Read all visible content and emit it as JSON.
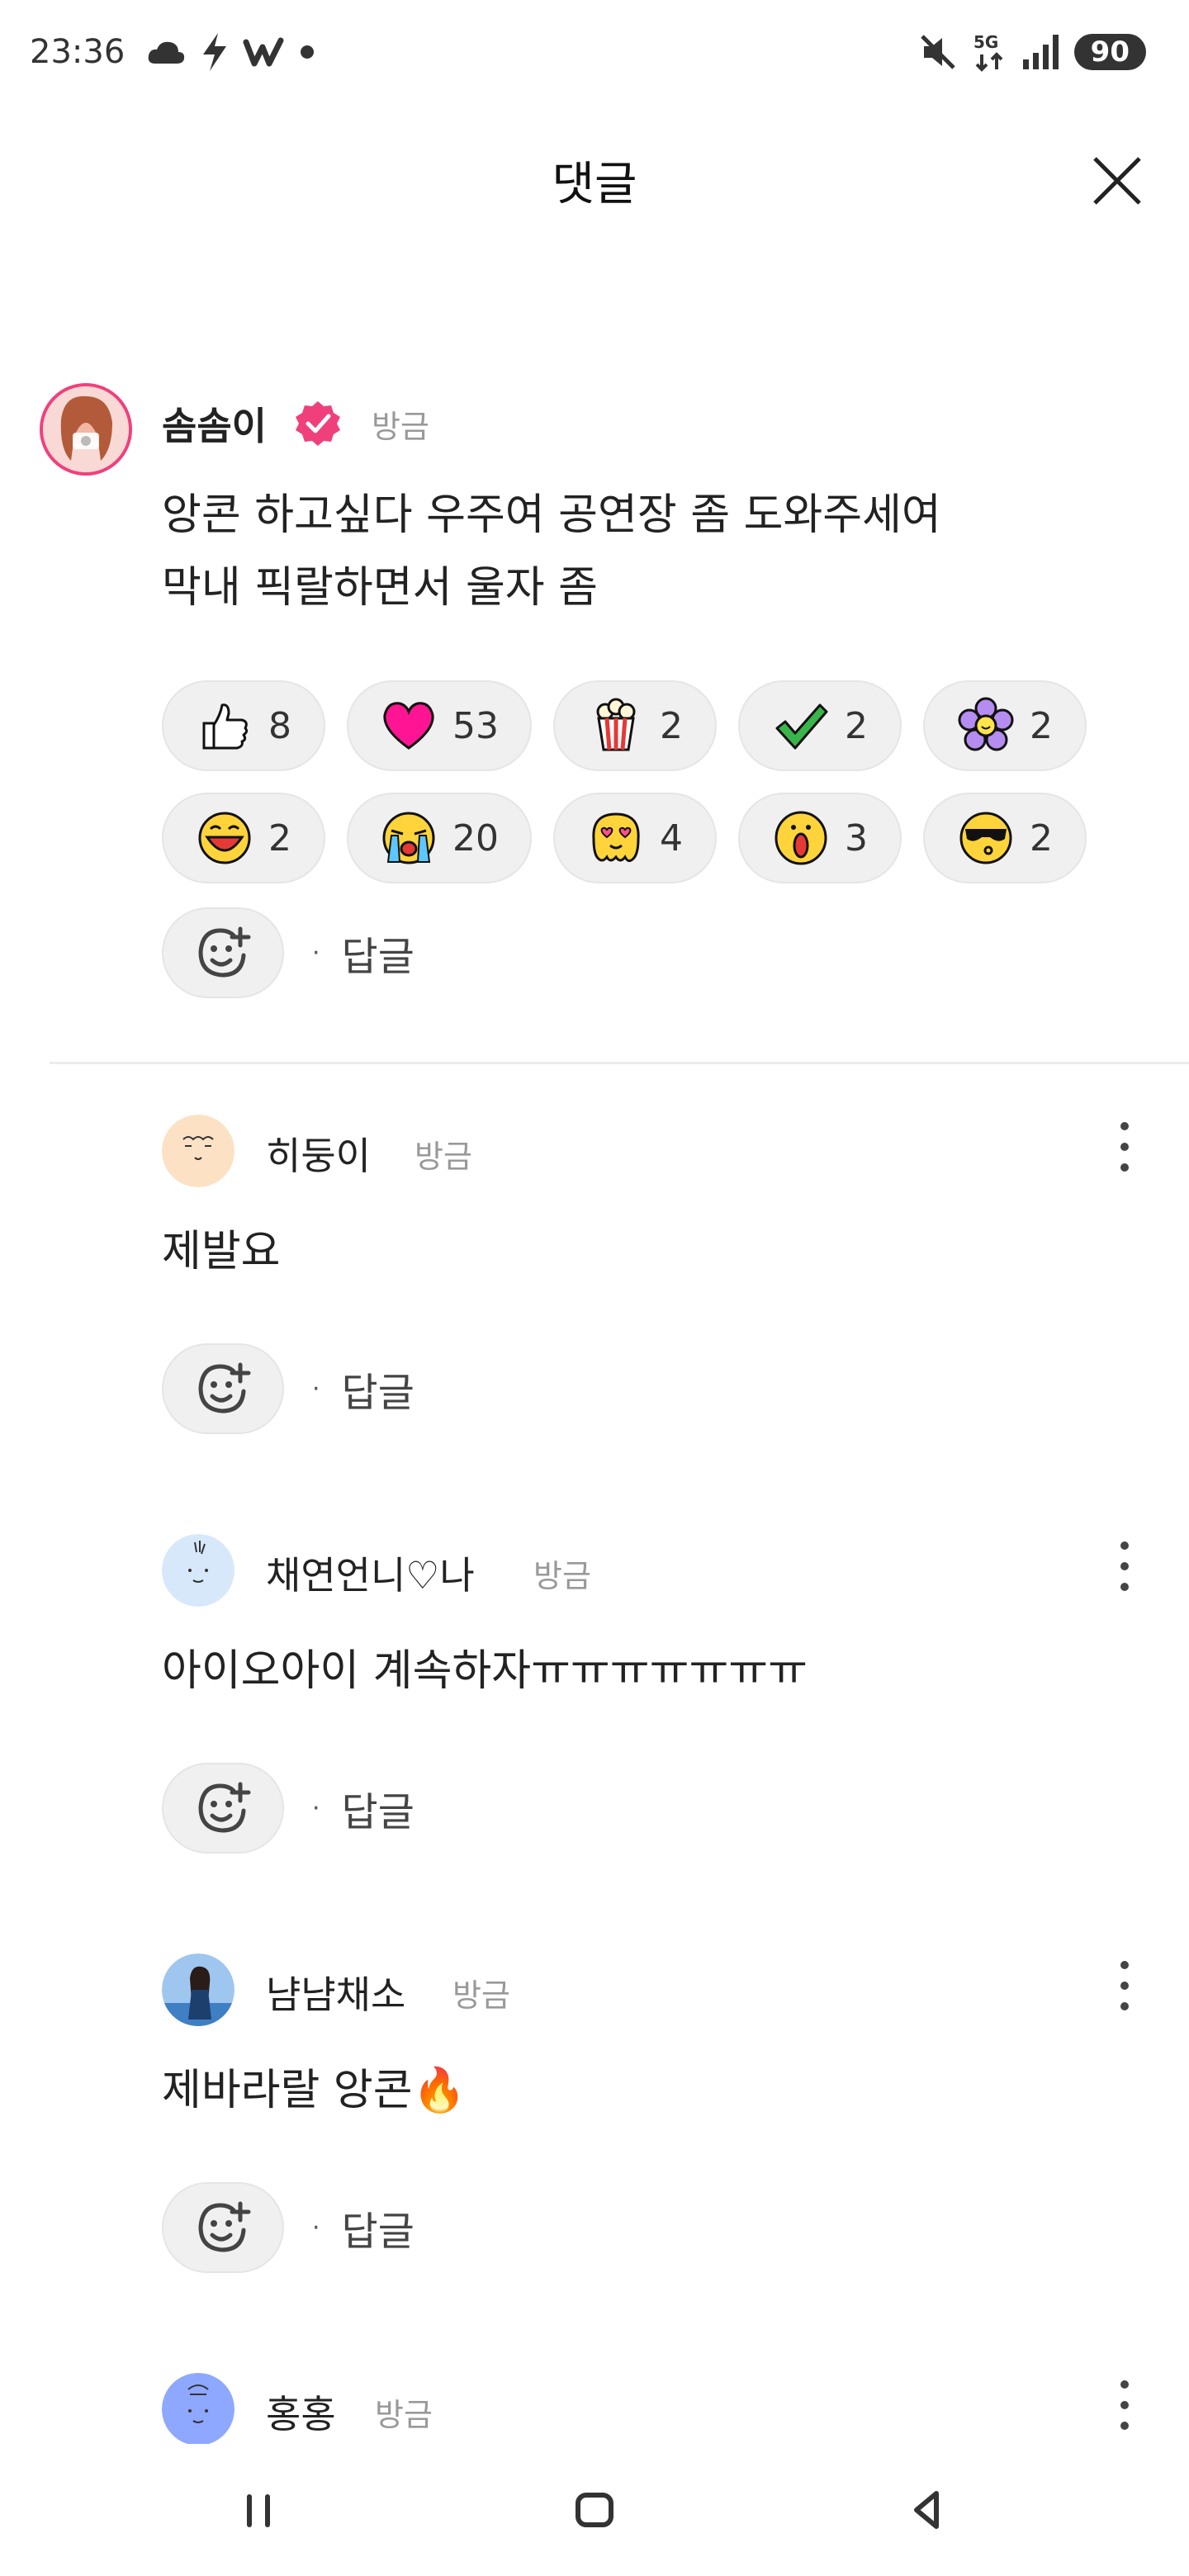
{
  "status_bar": {
    "time": "23:36",
    "battery": "90",
    "left_icons": [
      "cloud-icon",
      "bolt-icon",
      "weverse-w-icon",
      "dot-icon"
    ],
    "right_icons": [
      "mute-icon",
      "5g-icon",
      "signal-icon",
      "battery-icon"
    ]
  },
  "header": {
    "title": "댓글",
    "close_icon": "close-icon"
  },
  "main_comment": {
    "username": "솜솜이",
    "time": "방금",
    "text_line1": "앙콘 하고싶다 우주여 공연장 좀 도와주세여",
    "text_line2": "막내 픽랄하면서 울자 좀",
    "reactions": [
      {
        "icon": "thumbs-up-icon",
        "count": "8"
      },
      {
        "icon": "heart-icon",
        "count": "53"
      },
      {
        "icon": "popcorn-icon",
        "count": "2"
      },
      {
        "icon": "check-icon",
        "count": "2"
      },
      {
        "icon": "flower-icon",
        "count": "2"
      },
      {
        "icon": "laughing-face-icon",
        "count": "2"
      },
      {
        "icon": "crying-face-icon",
        "count": "20"
      },
      {
        "icon": "heart-eyes-face-icon",
        "count": "4"
      },
      {
        "icon": "surprised-face-icon",
        "count": "3"
      },
      {
        "icon": "sunglasses-face-icon",
        "count": "2"
      }
    ],
    "reply_label": "답글"
  },
  "replies": [
    {
      "username": "히둥이",
      "time": "방금",
      "text": "제발요",
      "reply_label": "답글"
    },
    {
      "username": "채연언니♡나",
      "time": "방금",
      "text": "아이오아이 계속하자ㅠㅠㅠㅠㅠㅠㅠ",
      "reply_label": "답글"
    },
    {
      "username": "냠냠채소",
      "time": "방금",
      "text": "제바라랄 앙콘🔥",
      "reply_label": "답글"
    },
    {
      "username": "홍홍",
      "time": "방금"
    }
  ],
  "colors": {
    "verified_badge": "#f0407c",
    "chip_bg": "#f0f0f0",
    "heart": "#ff1493",
    "check": "#39b54a"
  }
}
